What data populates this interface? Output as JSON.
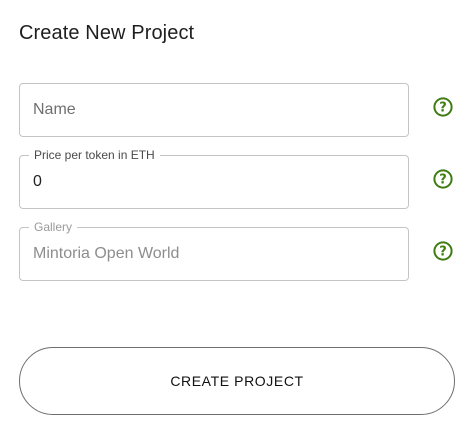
{
  "page": {
    "title": "Create New Project"
  },
  "form": {
    "name": {
      "placeholder": "Name",
      "value": ""
    },
    "price": {
      "label": "Price per token in ETH",
      "value": "0"
    },
    "gallery": {
      "label": "Gallery",
      "value": "Mintoria Open World"
    }
  },
  "help_icon": {
    "name": "help-circle-icon",
    "color": "#3f7d14"
  },
  "actions": {
    "create_label": "CREATE PROJECT"
  }
}
